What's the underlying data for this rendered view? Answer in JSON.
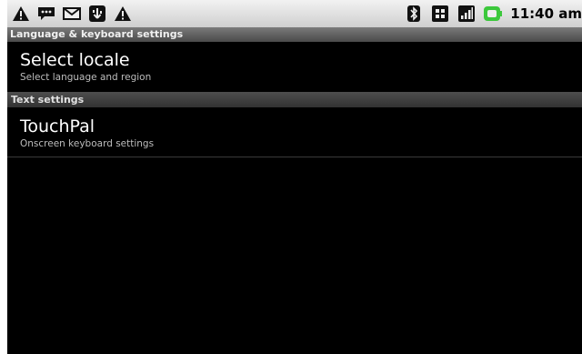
{
  "status_bar": {
    "left_icons": [
      "warning-icon",
      "chat-icon",
      "gmail-icon",
      "usb-icon",
      "warning-icon"
    ],
    "right_icons": [
      "bluetooth-icon",
      "sim-icon",
      "signal-icon",
      "battery-icon"
    ],
    "time": "11:40 am"
  },
  "title_bar": {
    "title": "Language & keyboard settings"
  },
  "items": [
    {
      "title": "Select locale",
      "summary": "Select language and region"
    }
  ],
  "section_header": "Text settings",
  "text_items": [
    {
      "title": "TouchPal",
      "summary": "Onscreen keyboard settings"
    }
  ],
  "colors": {
    "background": "#000000",
    "title_bar": "#5a5a5a",
    "status_bar": "#dddddd",
    "battery": "#3cc83c"
  }
}
